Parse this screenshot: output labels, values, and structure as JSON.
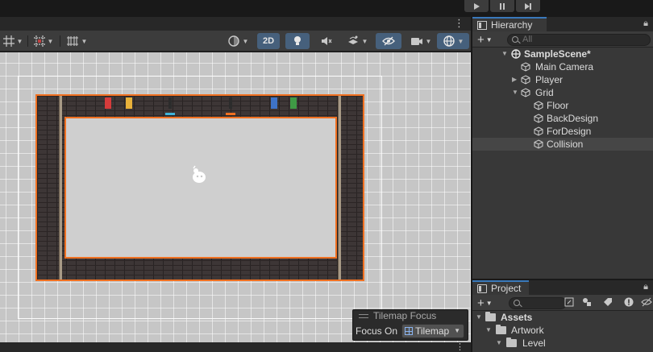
{
  "scene_view": {
    "toolbar": {
      "mode_2d_label": "2D"
    },
    "tilemap_focus": {
      "title": "Tilemap Focus",
      "focus_on_label": "Focus On",
      "focus_on_value": "Tilemap"
    }
  },
  "hierarchy": {
    "tab_label": "Hierarchy",
    "search_placeholder": "All",
    "items": [
      {
        "label": "SampleScene*",
        "depth": 0,
        "expanded": true
      },
      {
        "label": "Main Camera",
        "depth": 1
      },
      {
        "label": "Player",
        "depth": 1,
        "expanded": false
      },
      {
        "label": "Grid",
        "depth": 1,
        "expanded": true
      },
      {
        "label": "Floor",
        "depth": 2
      },
      {
        "label": "BackDesign",
        "depth": 2
      },
      {
        "label": "ForDesign",
        "depth": 2
      },
      {
        "label": "Collision",
        "depth": 2,
        "selected": true
      }
    ]
  },
  "project": {
    "tab_label": "Project",
    "folders": [
      {
        "label": "Assets",
        "depth": 0
      },
      {
        "label": "Artwork",
        "depth": 1
      },
      {
        "label": "Level",
        "depth": 2
      }
    ]
  },
  "colors": {
    "selection_outline": "#f07021",
    "active_toolbar_button": "#46607c",
    "tab_accent": "#3a79bb"
  }
}
